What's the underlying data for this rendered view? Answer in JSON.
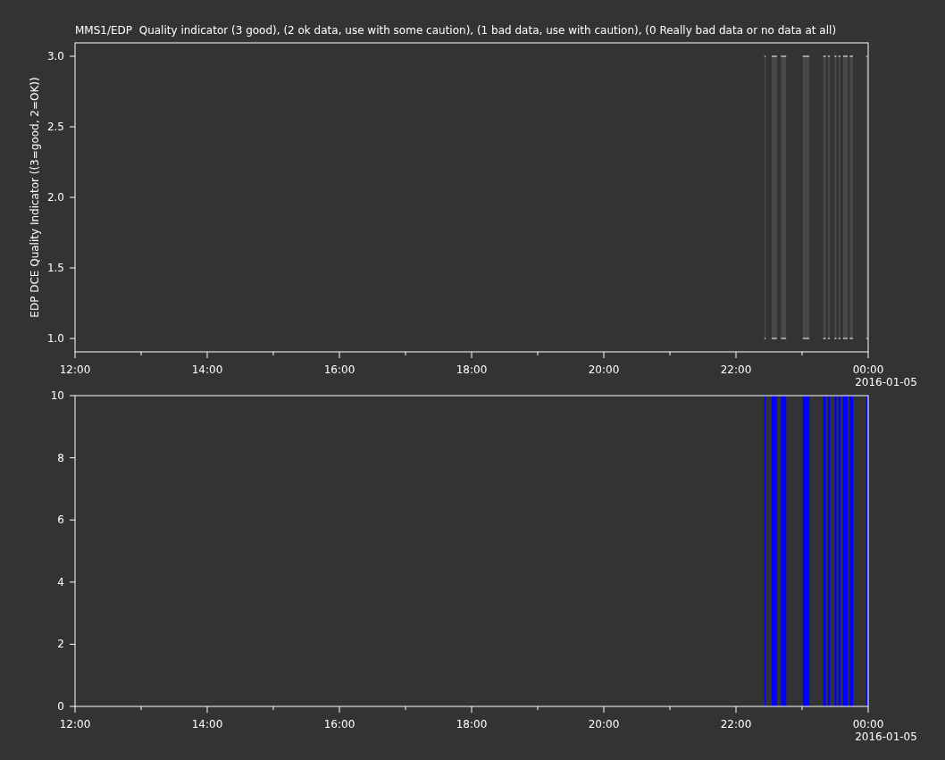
{
  "panels": [
    {
      "title": "MMS1/EDP  Quality indicator (3 good), (2 ok data, use with some caution), (1 bad data, use with caution), (0 Really bad data or no data at all)",
      "chart_data": {
        "type": "area",
        "ylabel": "EDP DCE Quality Indicator ((3=good, 2=OK))",
        "xlim": [
          12,
          24
        ],
        "ylim": [
          0.905,
          3.095
        ],
        "xticks": [
          {
            "value": 12,
            "label": "12:00"
          },
          {
            "value": 14,
            "label": "14:00"
          },
          {
            "value": 16,
            "label": "16:00"
          },
          {
            "value": 18,
            "label": "18:00"
          },
          {
            "value": 20,
            "label": "20:00"
          },
          {
            "value": 22,
            "label": "22:00"
          },
          {
            "value": 24,
            "label": "00:00"
          }
        ],
        "yticks": [
          {
            "value": 1,
            "label": "1.0"
          },
          {
            "value": 1.5,
            "label": "1.5"
          },
          {
            "value": 2,
            "label": "2.0"
          },
          {
            "value": 2.5,
            "label": "2.5"
          },
          {
            "value": 3,
            "label": "3.0"
          }
        ],
        "x": [
          22.43,
          22.45,
          22.5,
          22.54,
          22.62,
          22.65,
          22.68,
          22.76,
          22.9,
          23.01,
          23.11,
          23.2,
          23.32,
          23.36,
          23.38,
          23.39,
          23.42,
          23.45,
          23.49,
          23.52,
          23.53,
          23.55,
          23.58,
          23.6,
          23.62,
          23.69,
          23.7,
          23.72,
          23.77,
          23.9,
          23.97,
          23.99
        ],
        "series": [
          {
            "color": "#484848",
            "values": [
              3,
              3,
              null,
              3,
              3,
              null,
              3,
              3,
              null,
              3,
              3,
              null,
              3,
              3,
              null,
              3,
              3,
              null,
              3,
              3,
              null,
              3,
              3,
              null,
              3,
              3,
              null,
              3,
              3,
              null,
              3,
              3
            ]
          }
        ]
      },
      "date_label": "2016-01-05",
      "edge_marks": true
    },
    {
      "chart_data": {
        "type": "area",
        "xlim": [
          12,
          24
        ],
        "ylim": [
          0,
          10
        ],
        "xticks": [
          {
            "value": 12,
            "label": "12:00"
          },
          {
            "value": 14,
            "label": "14:00"
          },
          {
            "value": 16,
            "label": "16:00"
          },
          {
            "value": 18,
            "label": "18:00"
          },
          {
            "value": 20,
            "label": "20:00"
          },
          {
            "value": 22,
            "label": "22:00"
          },
          {
            "value": 24,
            "label": "00:00"
          }
        ],
        "yticks": [
          {
            "value": 0,
            "label": "0"
          },
          {
            "value": 2,
            "label": "2"
          },
          {
            "value": 4,
            "label": "4"
          },
          {
            "value": 6,
            "label": "6"
          },
          {
            "value": 8,
            "label": "8"
          },
          {
            "value": 10,
            "label": "10"
          }
        ],
        "x": [
          22.43,
          22.45,
          22.5,
          22.54,
          22.62,
          22.65,
          22.68,
          22.76,
          22.9,
          23.01,
          23.11,
          23.2,
          23.32,
          23.36,
          23.38,
          23.39,
          23.42,
          23.45,
          23.49,
          23.52,
          23.53,
          23.55,
          23.58,
          23.6,
          23.62,
          23.69,
          23.7,
          23.72,
          23.77,
          23.9,
          23.97,
          23.99
        ],
        "series": [
          {
            "color": "#0000ff",
            "values": [
              10,
              10,
              null,
              10,
              10,
              null,
              10,
              10,
              null,
              10,
              10,
              null,
              10,
              10,
              null,
              10,
              10,
              null,
              10,
              10,
              null,
              10,
              10,
              null,
              10,
              10,
              null,
              10,
              10,
              null,
              10,
              10
            ]
          }
        ]
      },
      "date_label": "2016-01-05",
      "edge_marks": false
    }
  ]
}
